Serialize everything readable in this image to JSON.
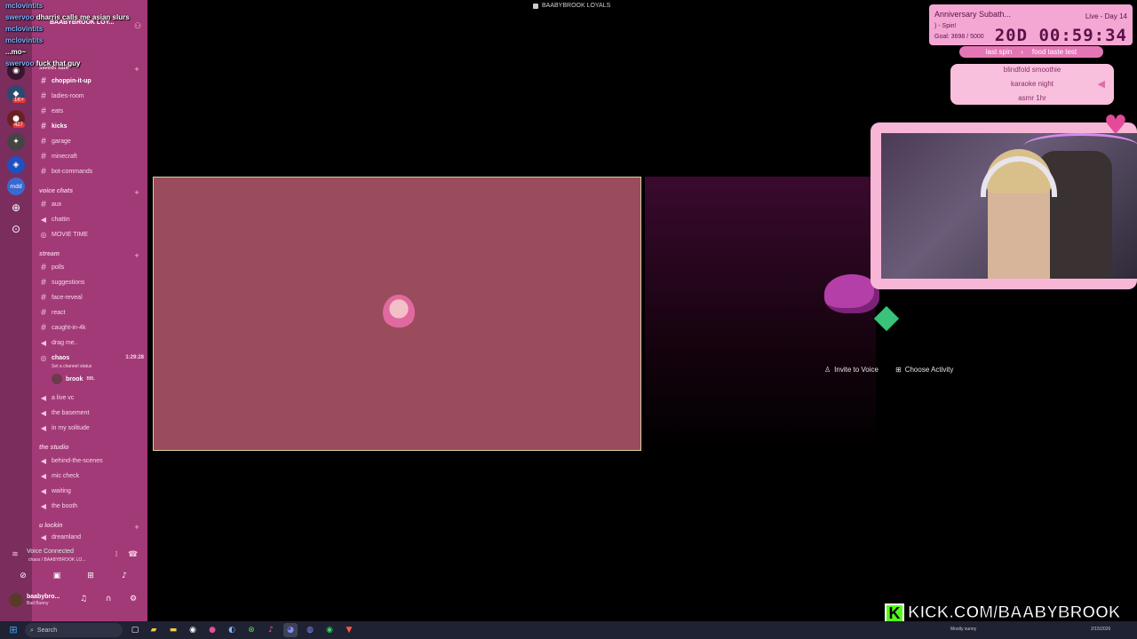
{
  "chat_overlay": [
    {
      "user": "mclovintits",
      "text": ""
    },
    {
      "user": "swervoo",
      "text": "dharris calls me asian slurs"
    },
    {
      "user": "mclovintits",
      "text": ""
    },
    {
      "user": "mclovintits",
      "text": ""
    },
    {
      "user": "",
      "text": "...mo~"
    },
    {
      "user": "swervoo",
      "text": "fuck that guy"
    }
  ],
  "server": {
    "name": "BAABYBROOK LOY..."
  },
  "window_title": "BAABYBROOK LOYALS",
  "rail": {
    "badges": [
      "1K+",
      "427"
    ],
    "mod_label": "mdd"
  },
  "categories": {
    "sweet": "sweet talk",
    "voice": "voice chats",
    "stream": "stream",
    "studio": "the studio",
    "lockin": "u lockin"
  },
  "channels": [
    {
      "label": "choppin-it-up",
      "kind": "text",
      "active": true
    },
    {
      "label": "ladies-room",
      "kind": "text"
    },
    {
      "label": "eats",
      "kind": "text"
    },
    {
      "label": "kicks",
      "kind": "text",
      "active": true
    },
    {
      "label": "garage",
      "kind": "text"
    },
    {
      "label": "minecraft",
      "kind": "text"
    },
    {
      "label": "bot-commands",
      "kind": "text"
    },
    {
      "label": "aux",
      "kind": "text"
    },
    {
      "label": "chattin",
      "kind": "voice"
    },
    {
      "label": "MOVIE TIME",
      "kind": "stage"
    },
    {
      "label": "polls",
      "kind": "text"
    },
    {
      "label": "suggestions",
      "kind": "text"
    },
    {
      "label": "face-reveal",
      "kind": "text"
    },
    {
      "label": "react",
      "kind": "text"
    },
    {
      "label": "caught-in-4k",
      "kind": "text"
    },
    {
      "label": "drag me..",
      "kind": "voice"
    },
    {
      "label": "chaos",
      "kind": "stage",
      "active": true,
      "time": "1:29:28"
    },
    {
      "label": "a live vc",
      "kind": "voice"
    },
    {
      "label": "the basement",
      "kind": "voice"
    },
    {
      "label": "in my solitude",
      "kind": "voice"
    },
    {
      "label": "behind-the-scenes",
      "kind": "voice"
    },
    {
      "label": "mic check",
      "kind": "voice"
    },
    {
      "label": "waiting",
      "kind": "voice"
    },
    {
      "label": "the booth",
      "kind": "voice"
    },
    {
      "label": "dreamland",
      "kind": "voice"
    }
  ],
  "channel_status": "Set a channel status",
  "member": {
    "name": "brook",
    "tag": "BBL"
  },
  "voice": {
    "status": "Voice Connected",
    "sub": "chaos / BAABYBROOK LO..."
  },
  "user_panel": {
    "name": "baabybro...",
    "status": "Bad Bunny"
  },
  "stage_actions": {
    "invite": "Invite to Voice",
    "activity": "Choose Activity"
  },
  "subathon": {
    "title": "Anniversary Subath...",
    "spin": ") - Spin!",
    "goal": "Goal: 3698 / 5000",
    "live": "Live - Day 14",
    "timer": "20D 00:59:34"
  },
  "wheel": {
    "last_label": "last spin",
    "last_value": "food taste test",
    "items": [
      "blindfold smoothie",
      "karaoke night",
      "asmr 1hr"
    ]
  },
  "kick": {
    "logo": "K",
    "url": "KICK.COM/BAABYBROOK"
  },
  "taskbar": {
    "search": "Search",
    "weather": "Mostly sunny",
    "date": "2/15/2026"
  }
}
